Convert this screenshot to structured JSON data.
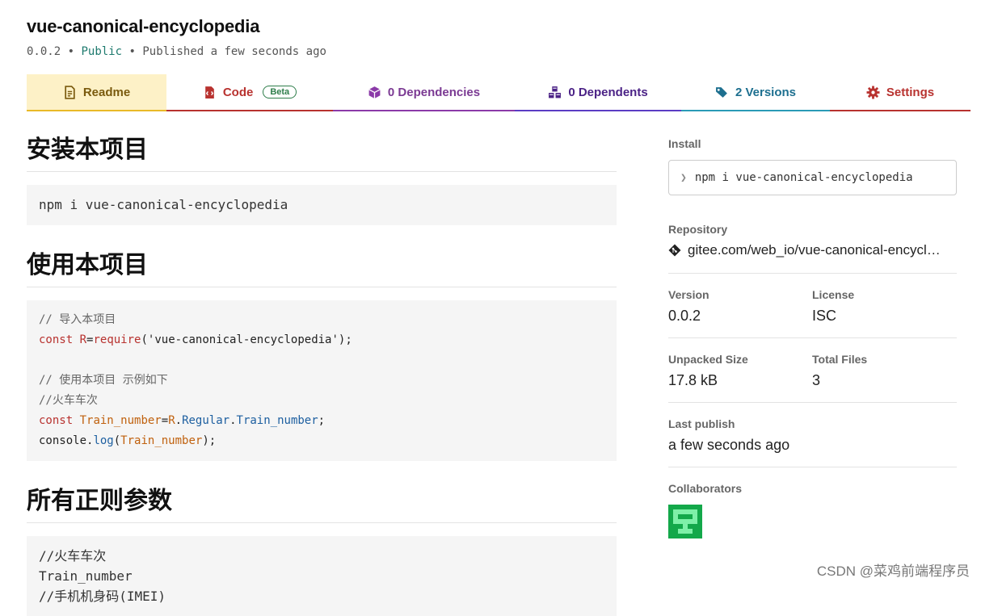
{
  "package": {
    "name": "vue-canonical-encyclopedia",
    "version": "0.0.2",
    "visibility": "Public",
    "published": "Published a few seconds ago",
    "bullet": "•"
  },
  "tabs": [
    {
      "label": "Readme"
    },
    {
      "label": "Code",
      "badge": "Beta"
    },
    {
      "label": "0 Dependencies"
    },
    {
      "label": "0 Dependents"
    },
    {
      "label": "2 Versions"
    },
    {
      "label": "Settings"
    }
  ],
  "readme": {
    "sections": [
      {
        "heading": "安装本项目",
        "code": "npm i vue-canonical-encyclopedia"
      },
      {
        "heading": "使用本项目"
      },
      {
        "heading": "所有正则参数"
      }
    ],
    "usage_code": {
      "c1": "// 导入本项目",
      "l2_kw": "const",
      "l2_var": "R",
      "l2_eq": "=",
      "l2_fn": "require",
      "l2_str": "('vue-canonical-encyclopedia');",
      "c3": "// 使用本项目 示例如下",
      "c4": "//火车车次",
      "l5_kw": "const",
      "l5_var": "Train_number",
      "l5_eq": "=",
      "l5_obj": "R",
      "l5_dot1": ".",
      "l5_p1": "Regular",
      "l5_dot2": ".",
      "l5_p2": "Train_number",
      "l5_end": ";",
      "l6_obj": "console.",
      "l6_fn": "log",
      "l6_open": "(",
      "l6_var": "Train_number",
      "l6_close": ");"
    },
    "params_code": [
      "//火车车次",
      "Train_number",
      "//手机机身码(IMEI)"
    ]
  },
  "sidebar": {
    "install_label": "Install",
    "install_cmd": "npm i vue-canonical-encyclopedia",
    "repository_label": "Repository",
    "repository_url": "gitee.com/web_io/vue-canonical-encycl…",
    "version_label": "Version",
    "version_value": "0.0.2",
    "license_label": "License",
    "license_value": "ISC",
    "unpacked_label": "Unpacked Size",
    "unpacked_value": "17.8 kB",
    "files_label": "Total Files",
    "files_value": "3",
    "last_publish_label": "Last publish",
    "last_publish_value": "a few seconds ago",
    "collaborators_label": "Collaborators"
  },
  "watermark": "CSDN @菜鸡前端程序员",
  "colors": {
    "readme_tab_bg": "#fdf1c7",
    "code_red": "#b8322f",
    "deps_purple": "#8b3aa8",
    "dependents_indigo": "#5b3cc4",
    "versions_teal": "#2a9bb6",
    "public_green": "#1e7a6e",
    "avatar_green": "#13a84a"
  },
  "icons": [
    "readme-icon",
    "code-icon",
    "package-icon",
    "dependents-icon",
    "tags-icon",
    "gear-icon",
    "git-icon",
    "avatar"
  ]
}
